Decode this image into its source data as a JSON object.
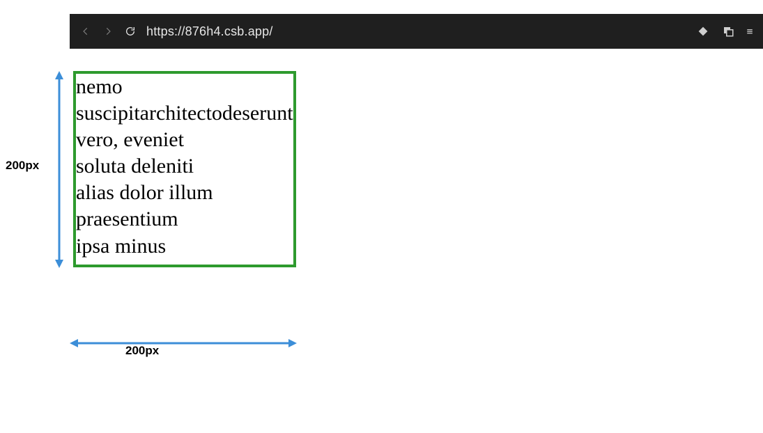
{
  "toolbar": {
    "url": "https://876h4.csb.app/"
  },
  "dimensions": {
    "width_label": "200px",
    "height_label": "200px"
  },
  "box": {
    "lines": [
      "nemo",
      "suscipitarchitectodeserunt",
      "vero, eveniet",
      "soluta deleniti",
      "alias dolor illum",
      "praesentium",
      "ipsa minus"
    ]
  },
  "colors": {
    "arrow": "#3c8ed8",
    "box_border": "#2e9a2e",
    "toolbar_bg": "#1f1f1f"
  }
}
